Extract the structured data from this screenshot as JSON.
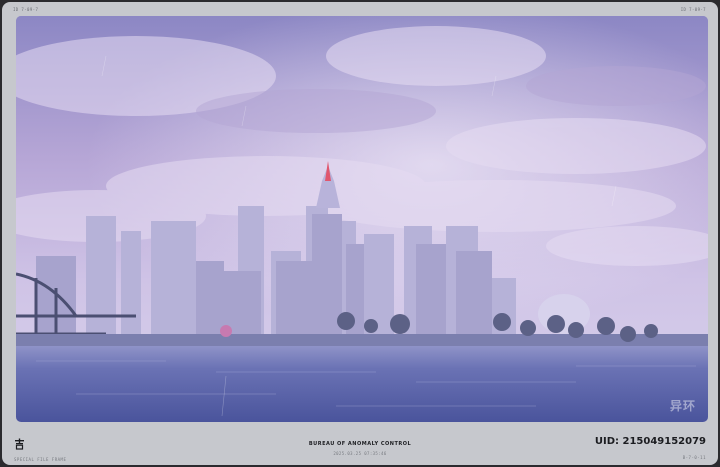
{
  "corner_labels": {
    "top_left": "ID  7-09-7",
    "top_right": "ID  7-09-7"
  },
  "photo": {
    "watermark": "异环"
  },
  "footer": {
    "left_small": "SPECIAL FILE FRAME",
    "center_title": "BUREAU OF ANOMALY CONTROL",
    "date": "2025.03.25 07:35:46",
    "uid": "UID: 215049152079",
    "right_small": "B-7-0-11"
  },
  "colors": {
    "frame": "#c6c8cd",
    "sky_top": "#8c8ac4",
    "water": "#4a55a0",
    "text_dark": "#1b1c20"
  }
}
